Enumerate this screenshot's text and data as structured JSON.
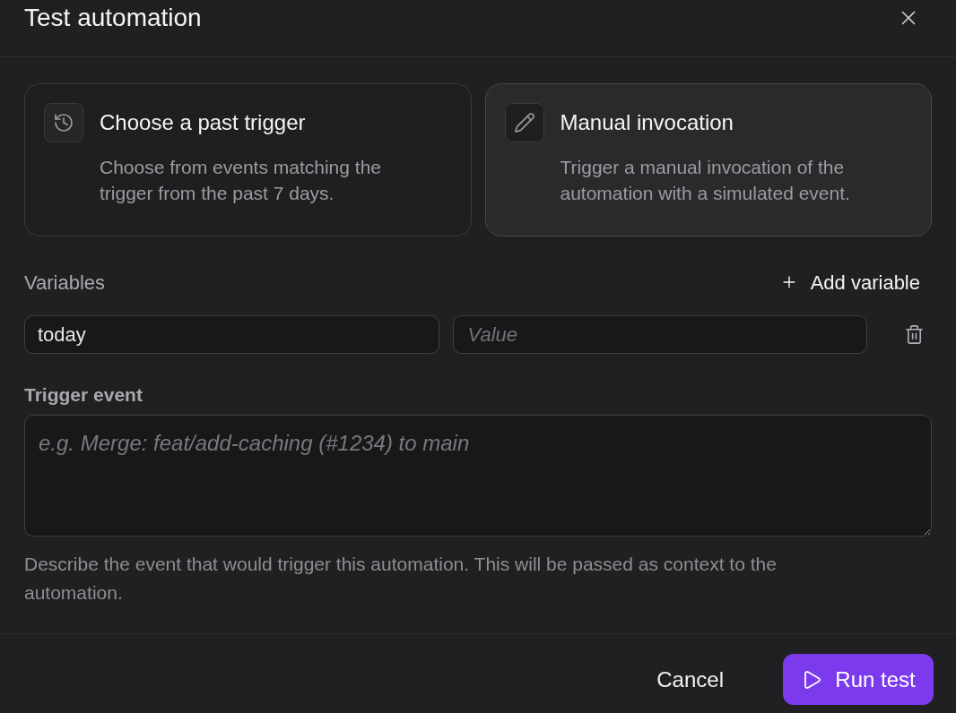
{
  "dialog": {
    "title": "Test automation"
  },
  "options": [
    {
      "kind": "history",
      "title": "Choose a past trigger",
      "description": "Choose from events matching the trigger from the past 7 days.",
      "selected": false
    },
    {
      "kind": "pencil",
      "title": "Manual invocation",
      "description": "Trigger a manual invocation of the automation with a simulated event.",
      "selected": true
    }
  ],
  "variables": {
    "label": "Variables",
    "add_button": "Add variable",
    "rows": [
      {
        "name": "today",
        "value_placeholder": "Value"
      }
    ]
  },
  "trigger_event": {
    "label": "Trigger event",
    "placeholder": "e.g. Merge: feat/add-caching (#1234) to main",
    "help": "Describe the event that would trigger this automation. This will be passed as context to the automation."
  },
  "footer": {
    "buttons": [
      {
        "kind": "secondary",
        "label": "Cancel"
      },
      {
        "kind": "primary",
        "label": "Run test"
      }
    ]
  }
}
